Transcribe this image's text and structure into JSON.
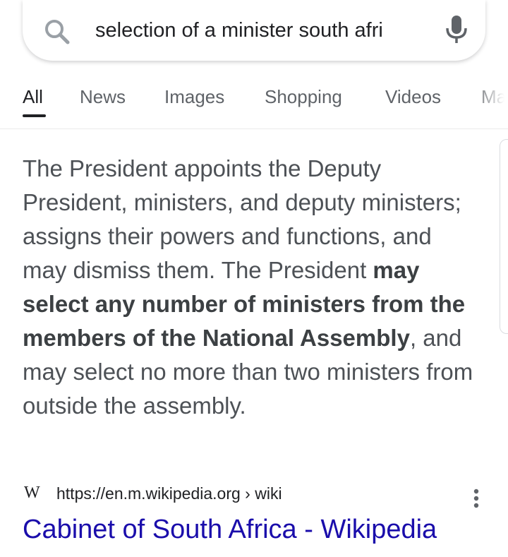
{
  "search": {
    "query": "selection of a minister south afri"
  },
  "tabs": [
    {
      "label": "All"
    },
    {
      "label": "News"
    },
    {
      "label": "Images"
    },
    {
      "label": "Shopping"
    },
    {
      "label": "Videos"
    },
    {
      "label": "Ma"
    }
  ],
  "snippet": {
    "part1": "The President appoints the Deputy President, ministers, and deputy ministers; assigns their powers and functions, and may dismiss them. The President ",
    "bold": "may select any number of ministers from the members of the National Assembly",
    "part2": ", and may select no more than two ministers from outside the assembly."
  },
  "result": {
    "site_icon_text": "W",
    "url": "https://en.m.wikipedia.org › wiki",
    "title": "Cabinet of South Africa - Wikipedia"
  },
  "colors": {
    "link": "#1a0dab",
    "text": "#4d5156",
    "tab_inactive": "#5f6368"
  }
}
